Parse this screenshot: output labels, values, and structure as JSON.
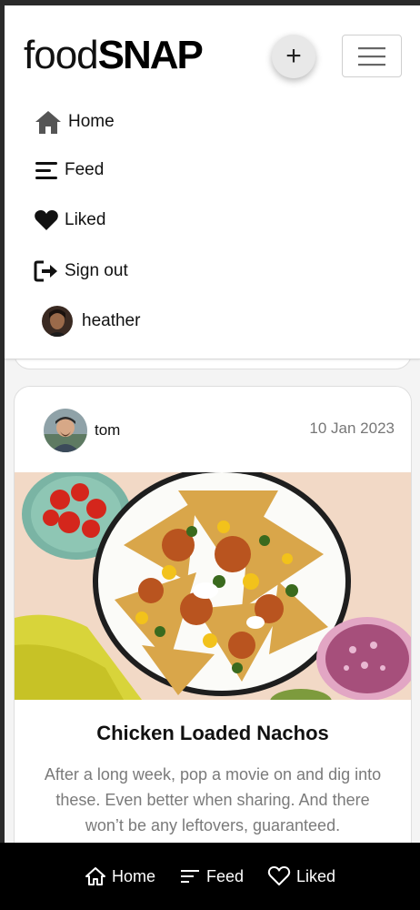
{
  "header": {
    "logo_light": "food",
    "logo_bold": "SNAP",
    "add_label": "+"
  },
  "menu": {
    "items": [
      {
        "label": "Home",
        "icon": "home-icon"
      },
      {
        "label": "Feed",
        "icon": "feed-icon"
      },
      {
        "label": "Liked",
        "icon": "heart-icon"
      },
      {
        "label": "Sign out",
        "icon": "sign-out-icon"
      }
    ],
    "user": {
      "name": "heather"
    }
  },
  "post": {
    "author": "tom",
    "date": "10 Jan 2023",
    "title": "Chicken Loaded Nachos",
    "description": "After a long week, pop a movie on and dig into these. Even better when sharing. And there won’t be any leftovers, guaranteed."
  },
  "bottom_nav": {
    "items": [
      {
        "label": "Home",
        "icon": "home-outline-icon"
      },
      {
        "label": "Feed",
        "icon": "feed-icon"
      },
      {
        "label": "Liked",
        "icon": "heart-outline-icon"
      }
    ]
  },
  "colors": {
    "background": "#f4f4f4",
    "bottom_bar": "#000000",
    "muted_text": "#7a7a7a"
  }
}
